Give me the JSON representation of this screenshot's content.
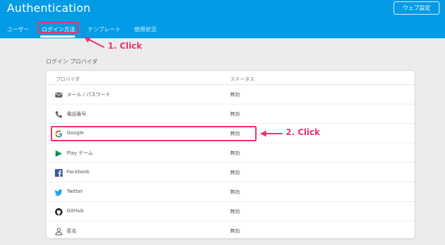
{
  "app": {
    "title": "Authentication",
    "web_setup_label": "ウェブ設定"
  },
  "tabs": [
    {
      "label": "ユーザー"
    },
    {
      "label": "ログイン方法",
      "active": true
    },
    {
      "label": "テンプレート"
    },
    {
      "label": "使用状況"
    }
  ],
  "annotations": {
    "step1": "1. Click",
    "step2": "2. Click",
    "color": "#e8336e"
  },
  "section": {
    "label": "ログイン プロバイダ"
  },
  "table": {
    "headers": {
      "provider": "プロバイダ",
      "status": "ステータス"
    },
    "rows": [
      {
        "name": "メール / パスワード",
        "status": "無効",
        "icon": "mail-icon"
      },
      {
        "name": "電話番号",
        "status": "無効",
        "icon": "phone-icon"
      },
      {
        "name": "Google",
        "status": "無効",
        "icon": "google-icon"
      },
      {
        "name": "Play ゲーム",
        "status": "無効",
        "icon": "play-games-icon"
      },
      {
        "name": "Facebook",
        "status": "無効",
        "icon": "facebook-icon"
      },
      {
        "name": "Twitter",
        "status": "無効",
        "icon": "twitter-icon"
      },
      {
        "name": "GitHub",
        "status": "無効",
        "icon": "github-icon"
      },
      {
        "name": "匿名",
        "status": "無効",
        "icon": "anonymous-icon"
      }
    ]
  },
  "colors": {
    "header": "#039be5",
    "annotation": "#e8336e",
    "page_bg": "#ececec"
  }
}
